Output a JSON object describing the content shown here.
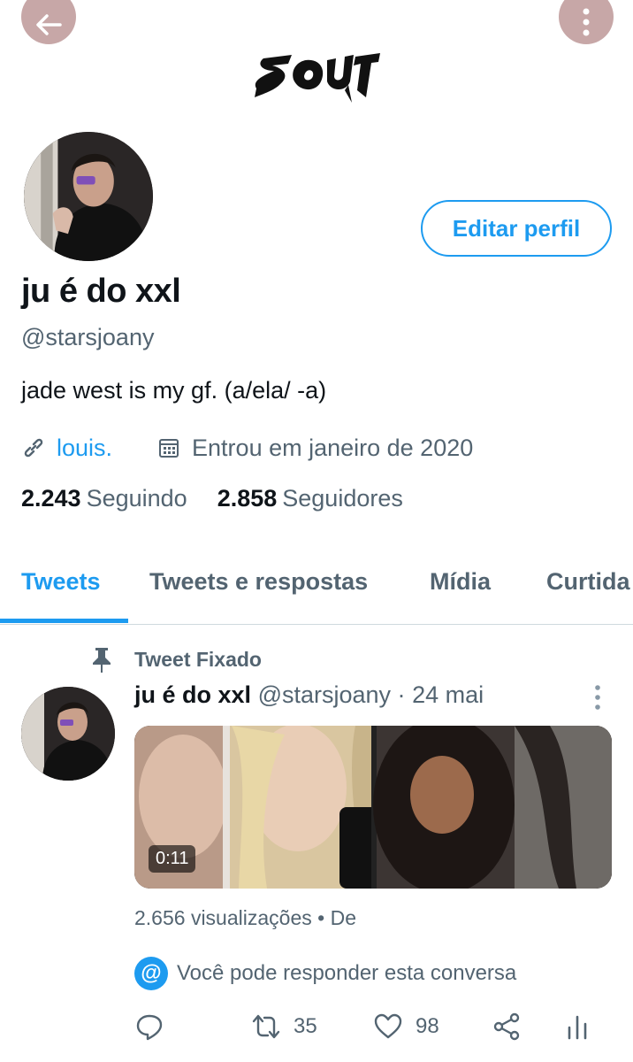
{
  "header": {
    "back_icon": "arrow-left-icon",
    "more_icon": "more-vertical-icon",
    "banner_logo_text": "SOUR"
  },
  "profile": {
    "edit_button_label": "Editar perfil",
    "display_name": "ju é do xxl",
    "handle": "@starsjoany",
    "bio": "jade west is my gf. (a/ela/ -a)",
    "website": "louis.",
    "joined": "Entrou em janeiro de 2020",
    "following_count": "2.243",
    "following_label": "Seguindo",
    "followers_count": "2.858",
    "followers_label": "Seguidores"
  },
  "tabs": [
    {
      "label": "Tweets",
      "active": true
    },
    {
      "label": "Tweets e respostas",
      "active": false
    },
    {
      "label": "Mídia",
      "active": false
    },
    {
      "label": "Curtida",
      "active": false
    }
  ],
  "tweet": {
    "pinned_label": "Tweet Fixado",
    "author_name": "ju é do xxl",
    "author_handle": "@starsjoany",
    "separator": "·",
    "date": "24 mai",
    "video_duration": "0:11",
    "views_text": "2.656 visualizações",
    "views_suffix": "De",
    "reply_notice": "Você pode responder esta conversa",
    "retweets": "35",
    "likes": "98"
  },
  "colors": {
    "accent": "#1d9bf0",
    "header_button_bg": "#c7a7a7",
    "secondary_text": "#536471"
  }
}
